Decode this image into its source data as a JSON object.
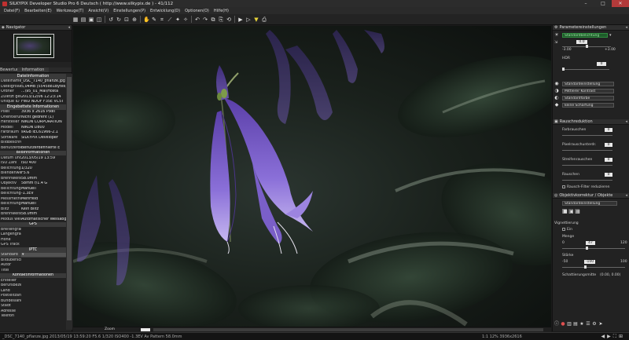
{
  "app": {
    "title": "SILKYPIX Developer Studio Pro 6 Deutsch ( http://www.silkypix.de ) - 41/112"
  },
  "window_buttons": {
    "minimize": "–",
    "maximize": "□",
    "close": "✕"
  },
  "menu": [
    "Datei(F)",
    "Bearbeiten(E)",
    "Werkzeuge(T)",
    "Ansicht(V)",
    "Einstellungen(P)",
    "Entwicklung(D)",
    "Optionen(O)",
    "Hilfe(H)"
  ],
  "left_panel": {
    "navigator_title": "Navigator",
    "tabs": [
      "Bewertung",
      "Information"
    ],
    "rows": [
      {
        "t": "sec",
        "v": "Dateiinformation"
      },
      {
        "t": "kv",
        "k": "Dateiname",
        "v": "_DSC_7140_pflanze.jpg"
      },
      {
        "t": "kv",
        "k": "Dateigröße",
        "v": "5,04MB (5545881Bytes)"
      },
      {
        "t": "kv",
        "k": "Ordner",
        "v": "...\\95_01_Mai\\Hosta"
      },
      {
        "t": "kv",
        "k": "Zuletzt gesichert",
        "v": "2013/12/06 12:23:14"
      },
      {
        "t": "kv",
        "k": "Unique ID",
        "v": "FWD NDOF F35E VC5T"
      },
      {
        "t": "sec",
        "v": "Eingebettete Informationen"
      },
      {
        "t": "kv",
        "k": "Pixel",
        "v": "3936 x 2616 Pixel"
      },
      {
        "t": "kv",
        "k": "Orientierung",
        "v": "Nicht gedreht (1)"
      },
      {
        "t": "kv",
        "k": "Hersteller",
        "v": "NIKON CORPORATION"
      },
      {
        "t": "kv",
        "k": "Modell",
        "v": "NIKON D800"
      },
      {
        "t": "kv",
        "k": "Farbraum",
        "v": "sRGB IEC61966-2.1"
      },
      {
        "t": "kv",
        "k": "Software",
        "v": "SILKYPIX Developer"
      },
      {
        "t": "kv",
        "k": "Bildbeschreibung",
        "v": ""
      },
      {
        "t": "kv",
        "k": "Benutzerdefiniert",
        "v": "Benutzerdefinierte E"
      },
      {
        "t": "sec",
        "v": "Bildinformationen"
      },
      {
        "t": "kv",
        "k": "Datum und Zeit",
        "v": "2013/05/19 13:59"
      },
      {
        "t": "kv",
        "k": "ISO Zahl",
        "v": "ISO 400"
      },
      {
        "t": "kv",
        "k": "Belichtungszeit",
        "v": "1/320"
      },
      {
        "t": "kv",
        "k": "Blendenwert",
        "v": "F5.6"
      },
      {
        "t": "kv",
        "k": "Brennweite",
        "v": "58.0mm"
      },
      {
        "t": "kv",
        "k": "Objektiv",
        "v": "58mm f/1.4 G"
      },
      {
        "t": "kv",
        "k": "Belichtungsprogramm",
        "v": "Manuell"
      },
      {
        "t": "kv",
        "k": "Belichtungskorrektur",
        "v": "-1.3EV"
      },
      {
        "t": "kv",
        "k": "Messmethode",
        "v": "Mehrfeld"
      },
      {
        "t": "kv",
        "k": "Belichtungsmodus",
        "v": "Manuell"
      },
      {
        "t": "kv",
        "k": "Blitz",
        "v": "Kein Blitz"
      },
      {
        "t": "kv",
        "k": "Brennweite (KB)",
        "v": "58.0mm"
      },
      {
        "t": "kv",
        "k": "Modus Weißabgleich",
        "v": "Automatischer Weißabgl."
      },
      {
        "t": "sec",
        "v": "GPS"
      },
      {
        "t": "kv",
        "k": "Breitengrad",
        "v": ""
      },
      {
        "t": "kv",
        "k": "Längengrad",
        "v": ""
      },
      {
        "t": "kv",
        "k": "Höhe",
        "v": ""
      },
      {
        "t": "kv",
        "k": "GPS Track",
        "v": ""
      },
      {
        "t": "sec",
        "v": "IPTC"
      },
      {
        "t": "sel",
        "k": "Standard",
        "v": "▾"
      },
      {
        "t": "kv",
        "k": "Bildüberschrift",
        "v": ""
      },
      {
        "t": "kv",
        "k": "Autor",
        "v": ""
      },
      {
        "t": "kv",
        "k": "Titel",
        "v": ""
      },
      {
        "t": "sec",
        "v": "Kontaktinformationen"
      },
      {
        "t": "kv",
        "k": "Ersteller",
        "v": ""
      },
      {
        "t": "kv",
        "k": "Berufsbezeichnung",
        "v": ""
      },
      {
        "t": "kv",
        "k": "Land",
        "v": ""
      },
      {
        "t": "kv",
        "k": "Postleitzahl",
        "v": ""
      },
      {
        "t": "kv",
        "k": "Bundesland",
        "v": ""
      },
      {
        "t": "kv",
        "k": "Stadt",
        "v": ""
      },
      {
        "t": "kv",
        "k": "Adresse",
        "v": ""
      },
      {
        "t": "kv",
        "k": "Telefon",
        "v": ""
      }
    ]
  },
  "right_panel": {
    "title": "Parametereinstellungen",
    "exposure_preset": "Standardbelichtung",
    "exposure_value": "0.0",
    "exposure_min": "-3.00",
    "exposure_max": "+3.00",
    "hdr_label": "HDR",
    "hdr_value": "0",
    "dropdowns": [
      "Standardeinstellung",
      "Mittlerer Kontrast",
      "Standardfarbe",
      "keine Schärfung"
    ],
    "noise_title": "Rauschreduktion",
    "noise_rows": [
      {
        "label": "Farbrauschen",
        "value": "0"
      },
      {
        "label": "Pixelrauschunterdr.",
        "value": "0"
      },
      {
        "label": "Streifenrauschen",
        "value": "0"
      },
      {
        "label": "Rauschen",
        "value": "0"
      }
    ],
    "noise_check": "Rausch-Filter reduzieren",
    "lens_title": "Objektivkorrektur / Objekte",
    "lens_preset": "Standardeinstellung",
    "vignette_label": "Vignettierung",
    "vignette_check": "Ein",
    "amount_label": "Menge",
    "amount_min": "0",
    "amount_value": "47",
    "amount_max": "120",
    "strength_label": "Stärke",
    "strength_min": "-50",
    "strength_value": "-100",
    "strength_max": "100",
    "shading_label": "Schattierungsmitte",
    "shading_value": "(0.00, 0.00)"
  },
  "zoom_label": "Zoom",
  "status": {
    "left": "_DSC_7140_pflanze.jpg 2013/05/19 13:59:20 F5.6 1/320 ISO400 -1.3EV Av Pattern 58.0mm",
    "middle": "1:1  12%  3936x2616"
  }
}
